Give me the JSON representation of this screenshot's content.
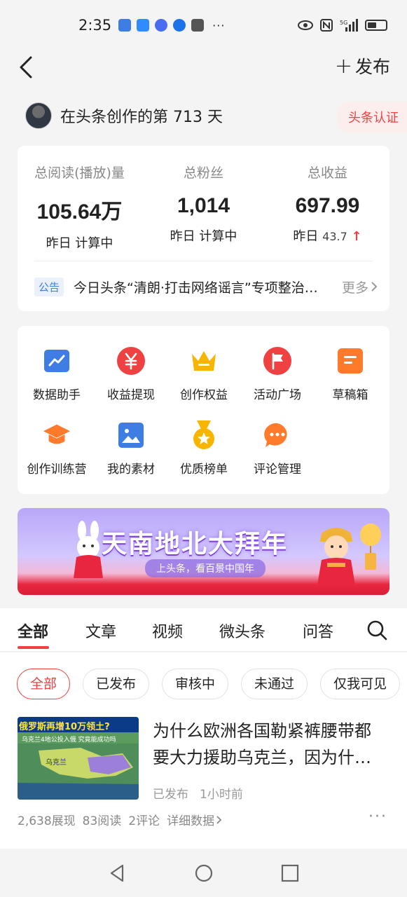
{
  "status_bar": {
    "time": "2:35",
    "more": "···",
    "network": "5G"
  },
  "topbar": {
    "publish_label": "发布"
  },
  "creator": {
    "text": "在头条创作的第 713 天",
    "badge": "头条认证"
  },
  "stats": [
    {
      "label": "总阅读(播放)量",
      "value": "105.64万",
      "sub_prefix": "昨日",
      "sub_value": "计算中"
    },
    {
      "label": "总粉丝",
      "value": "1,014",
      "sub_prefix": "昨日",
      "sub_value": "计算中"
    },
    {
      "label": "总收益",
      "value": "697.99",
      "sub_prefix": "昨日",
      "sub_value": "43.7",
      "trend": "↑"
    }
  ],
  "notice": {
    "tag": "公告",
    "text": "今日头条“清朗·打击网络谣言”专项整治行动",
    "more": "更多"
  },
  "tools": [
    {
      "label": "数据助手",
      "icon": "chart-icon",
      "color": "#3d7de4"
    },
    {
      "label": "收益提现",
      "icon": "yuan-icon",
      "color": "#f04142"
    },
    {
      "label": "创作权益",
      "icon": "crown-icon",
      "color": "#f7b500"
    },
    {
      "label": "活动广场",
      "icon": "flag-icon",
      "color": "#f04142"
    },
    {
      "label": "草稿箱",
      "icon": "draft-icon",
      "color": "#ff7a2a"
    },
    {
      "label": "创作训练营",
      "icon": "graduation-cap-icon",
      "color": "#ff7a2a"
    },
    {
      "label": "我的素材",
      "icon": "image-icon",
      "color": "#3d7de4"
    },
    {
      "label": "优质榜单",
      "icon": "medal-icon",
      "color": "#f7b500"
    },
    {
      "label": "评论管理",
      "icon": "comment-icon",
      "color": "#ff7a2a"
    }
  ],
  "banner": {
    "title": "天南地北大拜年",
    "subtitle": "上头条，看百景中国年"
  },
  "tabs": [
    "全部",
    "文章",
    "视频",
    "微头条",
    "问答"
  ],
  "filters": [
    "全部",
    "已发布",
    "审核中",
    "未通过",
    "仅我可见"
  ],
  "article": {
    "thumb_title": "俄罗斯再增10万领土?",
    "thumb_sub": "乌克兰4地公投入俄 究竟能成功吗",
    "thumb_map_label": "乌克兰",
    "title": "为什么欧洲各国勒紧裤腰带都要大力援助乌克兰，因为什么？",
    "status": "已发布",
    "time": "1小时前",
    "impressions": "2,638展现",
    "reads": "83阅读",
    "comments": "2评论",
    "detail": "详细数据",
    "more": "···"
  }
}
